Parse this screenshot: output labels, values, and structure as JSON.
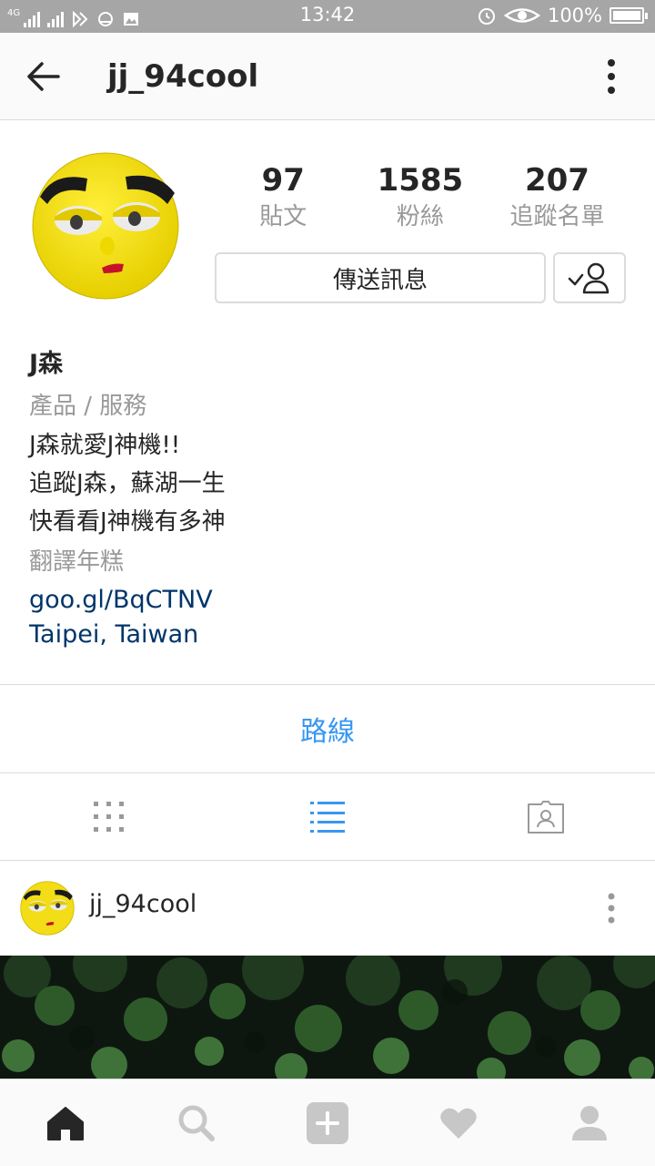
{
  "status_bar": {
    "network": "4G",
    "time": "13:42",
    "battery": "100%"
  },
  "app_bar": {
    "username": "jj_94cool"
  },
  "profile": {
    "stats": [
      {
        "value": "97",
        "label": "貼文"
      },
      {
        "value": "1585",
        "label": "粉絲"
      },
      {
        "value": "207",
        "label": "追蹤名單"
      }
    ],
    "message_button": "傳送訊息",
    "name": "J森",
    "category": "產品 / 服務",
    "bio_lines": [
      "J森就愛J神機!!",
      "追蹤J森，蘇湖一生",
      "快看看J神機有多神"
    ],
    "translate": "翻譯年糕",
    "link": "goo.gl/BqCTNV",
    "location": "Taipei, Taiwan"
  },
  "directions_label": "路線",
  "view_tabs": [
    {
      "icon": "grid-icon",
      "active": false
    },
    {
      "icon": "list-icon",
      "active": true
    },
    {
      "icon": "tagged-icon",
      "active": false
    }
  ],
  "post": {
    "username": "jj_94cool"
  },
  "bottom_nav": [
    {
      "icon": "home-icon",
      "active": true
    },
    {
      "icon": "search-icon",
      "active": false
    },
    {
      "icon": "add-post-icon",
      "active": false
    },
    {
      "icon": "heart-icon",
      "active": false
    },
    {
      "icon": "profile-icon",
      "active": false
    }
  ],
  "colors": {
    "accent": "#3897f0",
    "link": "#003569",
    "muted": "#999999",
    "border": "#dbdbdb"
  }
}
